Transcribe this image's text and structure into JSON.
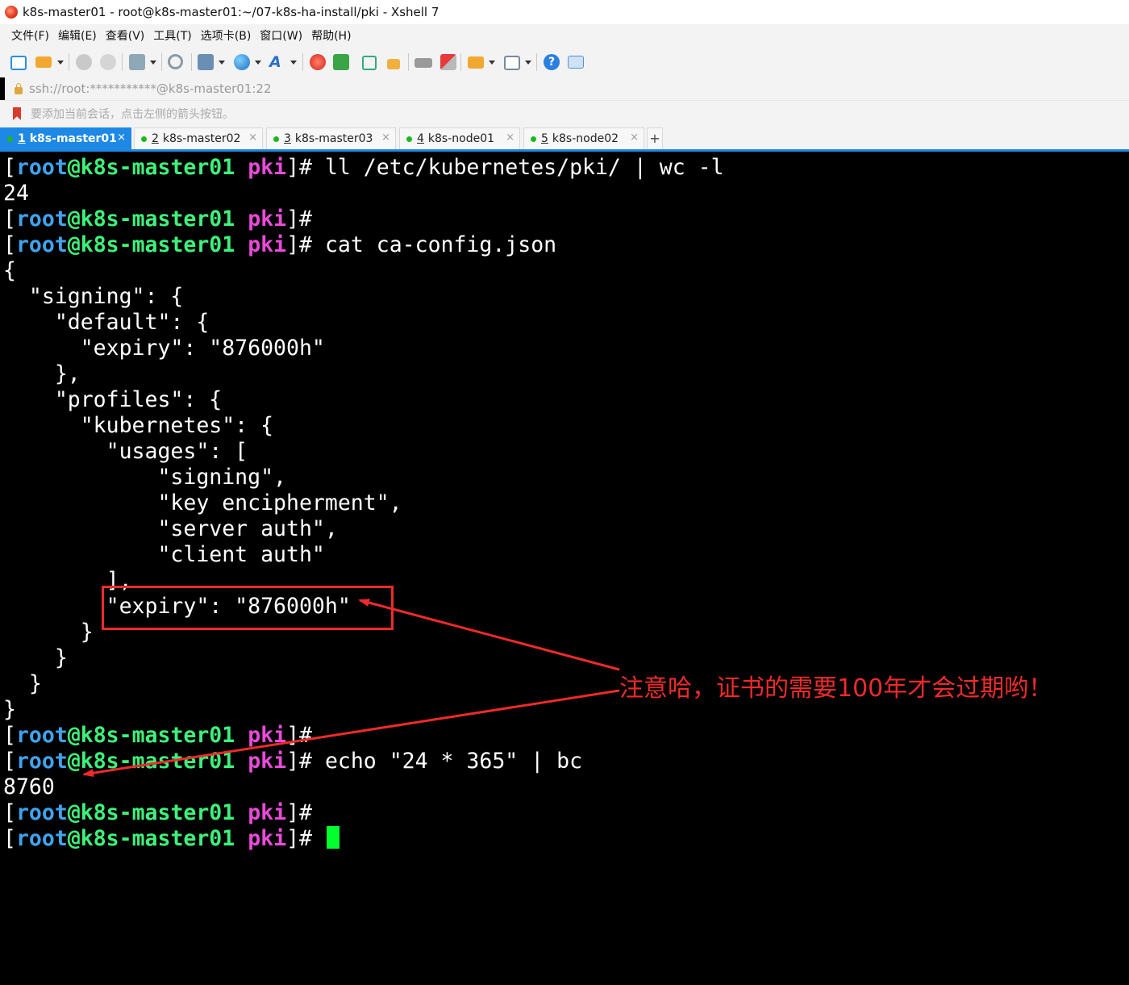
{
  "window": {
    "title": "k8s-master01 - root@k8s-master01:~/07-k8s-ha-install/pki - Xshell 7"
  },
  "menubar": {
    "items": [
      "文件(F)",
      "编辑(E)",
      "查看(V)",
      "工具(T)",
      "选项卡(B)",
      "窗口(W)",
      "帮助(H)"
    ]
  },
  "toolbar": {
    "icons": [
      "new-session-icon",
      "open-folder-icon",
      "reconnect-icon",
      "disconnect-icon",
      "properties-icon",
      "find-icon",
      "transfer-icon",
      "globe-icon",
      "font-icon",
      "xshell-icon",
      "xftp-icon",
      "fullscreen-icon",
      "lock-icon",
      "keyboard-icon",
      "script-icon",
      "compose-icon",
      "layout-icon",
      "help-icon",
      "chat-icon"
    ]
  },
  "address": {
    "text": "ssh://root:***********@k8s-master01:22"
  },
  "hint": {
    "text": "要添加当前会话，点击左侧的箭头按钮。"
  },
  "tabs": [
    {
      "num": "1",
      "label": "k8s-master01",
      "active": true
    },
    {
      "num": "2",
      "label": "k8s-master02",
      "active": false
    },
    {
      "num": "3",
      "label": "k8s-master03",
      "active": false
    },
    {
      "num": "4",
      "label": "k8s-node01",
      "active": false
    },
    {
      "num": "5",
      "label": "k8s-node02",
      "active": false
    }
  ],
  "tab_close": "×",
  "tab_add": "+",
  "prompt": {
    "open": "[",
    "user": "root",
    "at": "@",
    "host": "k8s-master01",
    "dir": "pki",
    "close": "]#"
  },
  "terminal_lines": [
    {
      "type": "prompt",
      "cmd": " ll /etc/kubernetes/pki/ | wc -l"
    },
    {
      "type": "output",
      "text": "24"
    },
    {
      "type": "prompt",
      "cmd": ""
    },
    {
      "type": "prompt",
      "cmd": " cat ca-config.json"
    },
    {
      "type": "output",
      "text": "{"
    },
    {
      "type": "output",
      "text": "  \"signing\": {"
    },
    {
      "type": "output",
      "text": "    \"default\": {"
    },
    {
      "type": "output",
      "text": "      \"expiry\": \"876000h\""
    },
    {
      "type": "output",
      "text": "    },"
    },
    {
      "type": "output",
      "text": "    \"profiles\": {"
    },
    {
      "type": "output",
      "text": "      \"kubernetes\": {"
    },
    {
      "type": "output",
      "text": "        \"usages\": ["
    },
    {
      "type": "output",
      "text": "            \"signing\","
    },
    {
      "type": "output",
      "text": "            \"key encipherment\","
    },
    {
      "type": "output",
      "text": "            \"server auth\","
    },
    {
      "type": "output",
      "text": "            \"client auth\""
    },
    {
      "type": "output",
      "text": "        ],"
    },
    {
      "type": "output",
      "text": "        \"expiry\": \"876000h\""
    },
    {
      "type": "output",
      "text": "      }"
    },
    {
      "type": "output",
      "text": "    }"
    },
    {
      "type": "output",
      "text": "  }"
    },
    {
      "type": "output",
      "text": "}"
    },
    {
      "type": "prompt",
      "cmd": ""
    },
    {
      "type": "prompt",
      "cmd": " echo \"24 * 365\" | bc"
    },
    {
      "type": "output",
      "text": "8760"
    },
    {
      "type": "prompt",
      "cmd": ""
    },
    {
      "type": "prompt",
      "cmd": " ",
      "cursor": true
    }
  ],
  "annotation": {
    "text": "注意哈，证书的需要100年才会过期哟！",
    "color": "#ef2a2a"
  },
  "colors": {
    "user": "#3ea4f0",
    "host": "#3ef17a",
    "dir": "#e84bd8",
    "cursor": "#00ff2e",
    "tab_active": "#1e88e5"
  }
}
